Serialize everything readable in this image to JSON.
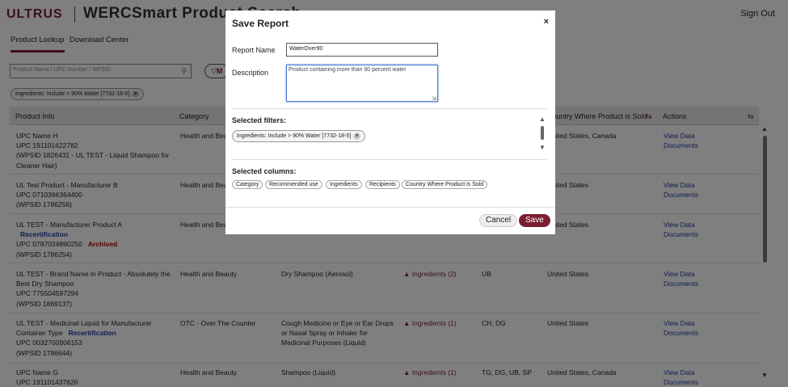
{
  "header": {
    "logo": "ULTRUS",
    "app_title": "WERCSmart Product Search",
    "sign_out": "Sign Out"
  },
  "tabs": [
    "Product Lookup",
    "Download Center"
  ],
  "search": {
    "placeholder": "Product Name / UPC Number / WPSID"
  },
  "more_button": "M",
  "active_filter": "Ingredients: Include > 90% Water [7732-18-5]",
  "table": {
    "headers": {
      "product_info": "Product Info",
      "category": "Category",
      "country": "Country Where Product is Sold",
      "actions": "Actions"
    },
    "rows": [
      {
        "info": [
          "UPC Name H",
          "UPC 191101422782",
          "(WPSID 1826431 - UL TEST - Liquid Shampoo for",
          "Cleaner Hair)"
        ],
        "category": "Health and Beauty",
        "recommended": "",
        "ingredients": "",
        "recipients": "",
        "country": "United States, Canada",
        "view": "View Data",
        "docs": "Documents"
      },
      {
        "info": [
          "UL Test Product - Manufacturer B",
          "UPC 0710366364400",
          "(WPSID 1786256)"
        ],
        "category": "Health and Beauty",
        "recommended": "",
        "ingredients": "",
        "recipients": "",
        "country": "United States",
        "view": "View Data",
        "docs": "Documents"
      },
      {
        "info": [
          "UL TEST - Manufacturer Product A"
        ],
        "recert": "Recertification",
        "upc": "UPC 0787024890250",
        "archived": "Archived",
        "wpsid": "(WPSID 1786254)",
        "category": "Health and Beauty",
        "country": "United States",
        "view": "View Data",
        "docs": "Documents"
      },
      {
        "info": [
          "UL TEST - Brand Name in Product - Absolutely the",
          "Best Dry Shampoo",
          "UPC 775504597294",
          "(WPSID 1869137)"
        ],
        "category": "Health and Beauty",
        "recommended": "Dry Shampoo (Aerosol)",
        "ingredients": "Ingredients (2)",
        "recipients": "UB",
        "country": "United States",
        "view": "View Data",
        "docs": "Documents"
      },
      {
        "info": [
          "UL TEST - Medicinal Liquid for Manufacturer",
          "Container Type"
        ],
        "recert": "Recertification",
        "upc": "UPC 0032700906153",
        "wpsid": "(WPSID 1786644)",
        "category": "OTC - Over The Counter",
        "recommended": "Cough Medicine or Eye or Ear Drops or Nasal Spray or Inhaler for Medicinal Purposes (Liquid)",
        "ingredients": "Ingredients (1)",
        "recipients": "CH, DG",
        "country": "United States",
        "view": "View Data",
        "docs": "Documents"
      },
      {
        "info": [
          "UPC Name G",
          "UPC 191101437626"
        ],
        "category": "Health and Beauty",
        "recommended": "Shampoo (Liquid)",
        "ingredients": "Ingredients (1)",
        "recipients": "TG, DG, UB, SP",
        "country": "United States, Canada",
        "view": "View Data",
        "docs": "Documents"
      }
    ]
  },
  "modal": {
    "title": "Save Report",
    "close": "×",
    "report_name_label": "Report Name",
    "report_name_value": "WaterOver90",
    "description_label": "Description",
    "description_value": "Product containing more than 90 percent water",
    "selected_filters_label": "Selected filters:",
    "selected_filter": "Ingredients: Include > 90% Water [7732-18-5]",
    "selected_columns_label": "Selected columns:",
    "columns": [
      "Category",
      "Recommended use",
      "Ingredients",
      "Recipients",
      "Country Where Product is Sold"
    ],
    "cancel": "Cancel",
    "save": "Save"
  },
  "colors": {
    "brand": "#7a1f33",
    "link": "#1c3c9c",
    "archived": "#bb0000"
  },
  "icons": [
    "search-icon",
    "filter-icon",
    "close-icon",
    "sort-icon",
    "ingredient-warning-icon",
    "scroll-up-icon",
    "scroll-down-icon"
  ]
}
